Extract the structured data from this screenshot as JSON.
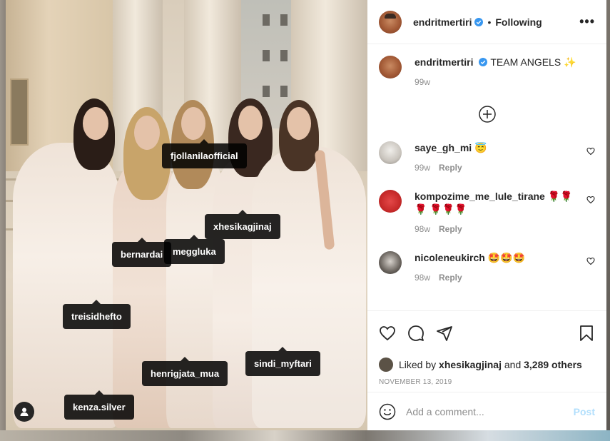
{
  "post": {
    "username": "endritmertiri",
    "follow_status": "Following",
    "separator": "•",
    "more_label": "•••",
    "caption": {
      "text": "TEAM ANGELS",
      "emoji": "✨",
      "age": "99w"
    },
    "photo_tags": [
      {
        "label": "fjollanilaofficial"
      },
      {
        "label": "xhesikagjinaj"
      },
      {
        "label": "bernardai"
      },
      {
        "label": "meggluka"
      },
      {
        "label": "treisidhefto"
      },
      {
        "label": "henrigjata_mua"
      },
      {
        "label": "sindi_myftari"
      },
      {
        "label": "kenza.silver"
      }
    ],
    "comments": [
      {
        "user": "saye_gh_mi",
        "text": "😇",
        "age": "99w",
        "reply": "Reply"
      },
      {
        "user": "kompozime_me_lule_tirane",
        "text": "🌹🌹🌹 🌹🌹🌹",
        "age": "98w",
        "reply": "Reply"
      },
      {
        "user": "nicoleneukirch",
        "text": "🤩🤩🤩",
        "age": "98w",
        "reply": "Reply"
      }
    ],
    "likes": {
      "prefix": "Liked by",
      "liker": "xhesikagjinaj",
      "joiner": "and",
      "others": "3,289 others"
    },
    "date": "NOVEMBER 13, 2019",
    "add_comment": {
      "placeholder": "Add a comment...",
      "post_label": "Post"
    }
  },
  "colors": {
    "verified": "#3897f0",
    "post_button": "#b2dffc",
    "muted_text": "#8e8e8e",
    "text": "#262626"
  }
}
